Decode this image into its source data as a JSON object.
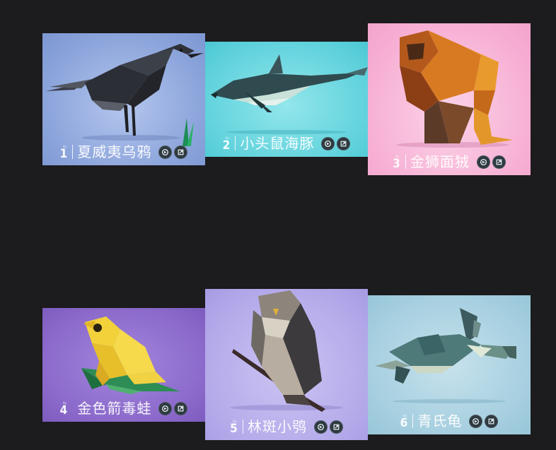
{
  "cards": [
    {
      "number": "1",
      "name": "夏威夷乌鸦",
      "background": "#8fa8dc",
      "icon": "crow-illustration"
    },
    {
      "number": "2",
      "name": "小头鼠海豚",
      "background": "#5fd2dc",
      "icon": "porpoise-illustration"
    },
    {
      "number": "3",
      "name": "金狮面狨",
      "background": "#f7b0d4",
      "icon": "tamarin-illustration"
    },
    {
      "number": "4",
      "name": "金色箭毒蛙",
      "background": "#8a69c8",
      "icon": "poison-frog-illustration"
    },
    {
      "number": "5",
      "name": "林斑小鸮",
      "background": "#b4aaea",
      "icon": "owlet-illustration"
    },
    {
      "number": "6",
      "name": "青氏龟",
      "background": "#a6cfe0",
      "icon": "sea-turtle-illustration"
    }
  ],
  "buttons": {
    "play_icon": "play-icon",
    "info_icon": "share-icon"
  }
}
